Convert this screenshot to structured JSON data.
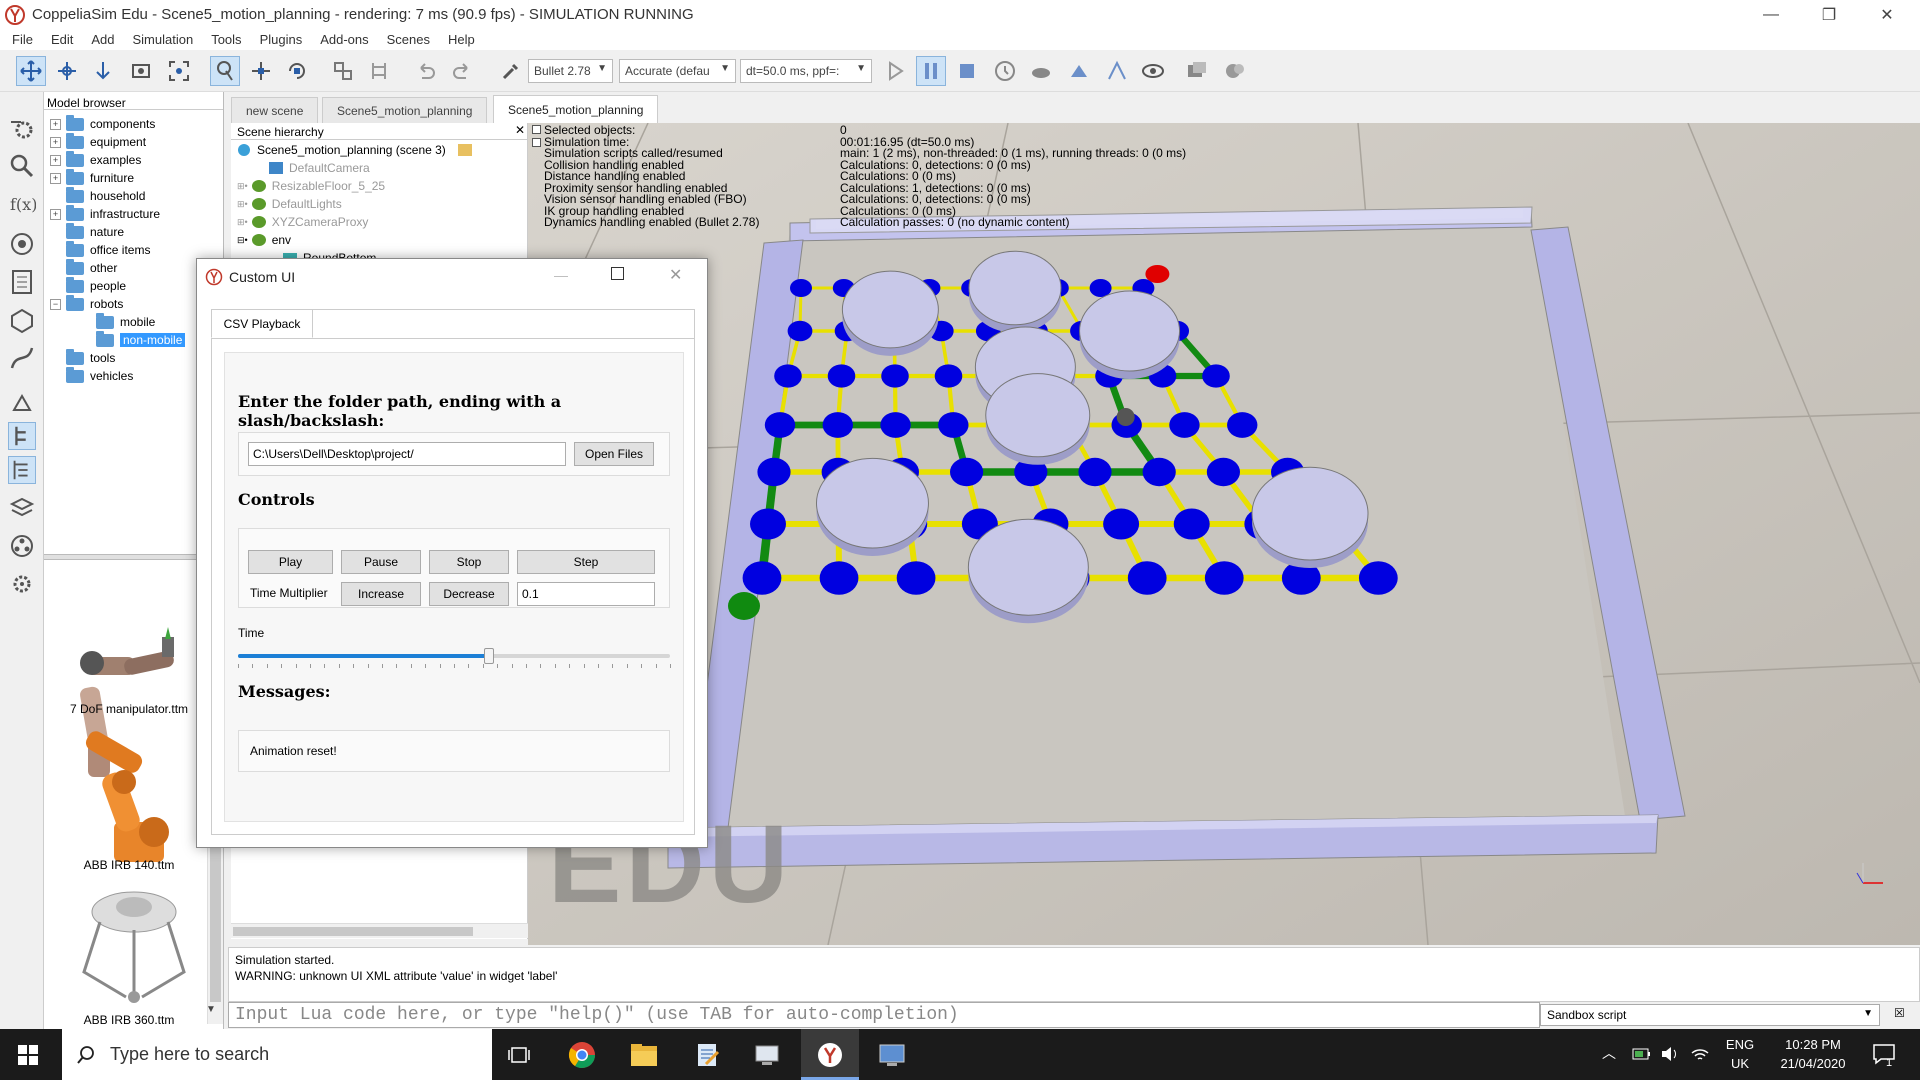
{
  "window": {
    "title": "CoppeliaSim Edu - Scene5_motion_planning - rendering: 7 ms (90.9 fps) - SIMULATION RUNNING",
    "minimize": "—",
    "maximize": "❐",
    "close": "✕"
  },
  "menu": [
    "File",
    "Edit",
    "Add",
    "Simulation",
    "Tools",
    "Plugins",
    "Add-ons",
    "Scenes",
    "Help"
  ],
  "toolbar": {
    "engine": "Bullet 2.78",
    "accuracy": "Accurate (defau",
    "dt": "dt=50.0 ms, ppf=:"
  },
  "model_browser": {
    "title": "Model browser",
    "items": [
      {
        "label": "components",
        "exp": "+"
      },
      {
        "label": "equipment",
        "exp": "+"
      },
      {
        "label": "examples",
        "exp": "+"
      },
      {
        "label": "furniture",
        "exp": "+"
      },
      {
        "label": "household",
        "exp": ""
      },
      {
        "label": "infrastructure",
        "exp": "+"
      },
      {
        "label": "nature",
        "exp": ""
      },
      {
        "label": "office items",
        "exp": ""
      },
      {
        "label": "other",
        "exp": ""
      },
      {
        "label": "people",
        "exp": ""
      },
      {
        "label": "robots",
        "exp": "−"
      },
      {
        "label": "mobile",
        "exp": ""
      },
      {
        "label": "non-mobile",
        "exp": ""
      },
      {
        "label": "tools",
        "exp": ""
      },
      {
        "label": "vehicles",
        "exp": ""
      }
    ],
    "thumbnails": [
      "7 DoF manipulator.ttm",
      "ABB IRB 140.ttm",
      "ABB IRB 360.ttm"
    ]
  },
  "tabs": [
    "new scene",
    "Scene5_motion_planning",
    "Scene5_motion_planning"
  ],
  "scene_hierarchy": {
    "title": "Scene hierarchy",
    "items": [
      "Scene5_motion_planning (scene 3)",
      "DefaultCamera",
      "ResizableFloor_5_25",
      "DefaultLights",
      "XYZCameraProxy",
      "env",
      "RoundBottom"
    ]
  },
  "stats": {
    "labels": [
      "Selected objects:",
      "Simulation time:",
      "Simulation scripts called/resumed",
      "Collision handling enabled",
      "Distance handling enabled",
      "Proximity sensor handling enabled",
      "Vision sensor handling enabled (FBO)",
      "IK group handling enabled",
      "Dynamics handling enabled (Bullet 2.78)"
    ],
    "values": [
      "0",
      "00:01:16.95 (dt=50.0 ms)",
      "main: 1 (2 ms), non-threaded: 0 (1 ms), running threads: 0 (0 ms)",
      "Calculations: 0, detections: 0 (0 ms)",
      "Calculations: 0 (0 ms)",
      "Calculations: 1, detections: 0 (0 ms)",
      "Calculations: 0, detections: 0 (0 ms)",
      "Calculations: 0 (0 ms)",
      "Calculation passes: 0 (no dynamic content)"
    ]
  },
  "watermark": "EDU",
  "dialog": {
    "title": "Custom UI",
    "tab": "CSV Playback",
    "heading": "Enter the folder path, ending with a slash/backslash:",
    "path_value": "C:\\Users\\Dell\\Desktop\\project/",
    "open_files": "Open Files",
    "controls_label": "Controls",
    "play": "Play",
    "pause": "Pause",
    "stop": "Stop",
    "step": "Step",
    "time_multiplier_label": "Time Multiplier",
    "increase": "Increase",
    "decrease": "Decrease",
    "multiplier_value": "0.1",
    "time_label": "Time",
    "time_slider": 0.58,
    "messages_label": "Messages:",
    "message": "Animation reset!"
  },
  "console": {
    "lines": [
      "Simulation started.",
      "WARNING: unknown UI XML attribute 'value' in widget 'label'"
    ],
    "placeholder": "Input Lua code here, or type \"help()\" (use TAB for auto-completion)",
    "script_select": "Sandbox script"
  },
  "taskbar": {
    "search_placeholder": "Type here to search",
    "lang1": "ENG",
    "lang2": "UK",
    "time": "10:28 PM",
    "date": "21/04/2020",
    "notif_count": "1"
  },
  "colors": {
    "node": "#0000e0",
    "edge_yellow": "#e8e000",
    "edge_green": "#128a12",
    "start": "#108a10",
    "goal": "#e00000",
    "wall": "#b8b8e8",
    "obstacle": "#c8c8e8"
  }
}
